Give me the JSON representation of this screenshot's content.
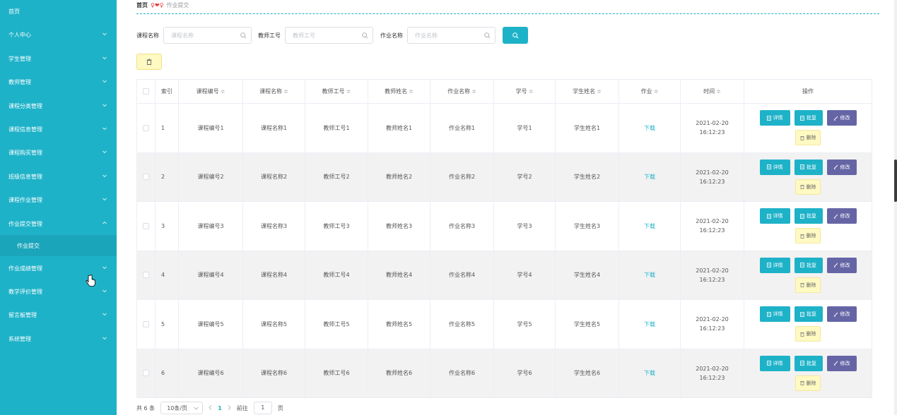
{
  "sidebar": {
    "items": [
      {
        "label": "首页",
        "chevron": false
      },
      {
        "label": "个人中心",
        "chevron": true
      },
      {
        "label": "学生管理",
        "chevron": true
      },
      {
        "label": "教师管理",
        "chevron": true
      },
      {
        "label": "课程分类管理",
        "chevron": true
      },
      {
        "label": "课程信息管理",
        "chevron": true
      },
      {
        "label": "课程购买管理",
        "chevron": true
      },
      {
        "label": "班级信息管理",
        "chevron": true
      },
      {
        "label": "课程作业管理",
        "chevron": true
      },
      {
        "label": "作业提交管理",
        "chevron": true,
        "expanded": true
      },
      {
        "label": "作业成绩管理",
        "chevron": true
      },
      {
        "label": "教学评价管理",
        "chevron": true
      },
      {
        "label": "留言板管理",
        "chevron": true
      },
      {
        "label": "系统管理",
        "chevron": true
      }
    ],
    "sub_item": "作业提交"
  },
  "breadcrumb": {
    "home": "首页",
    "separator": "♀❤♀",
    "current": "作业提交"
  },
  "filters": [
    {
      "label": "课程名称",
      "placeholder": "课程名称"
    },
    {
      "label": "教师工号",
      "placeholder": "教师工号"
    },
    {
      "label": "作业名称",
      "placeholder": "作业名称"
    }
  ],
  "table": {
    "headers": {
      "index": "索引",
      "course_no": "课程编号",
      "course_name": "课程名称",
      "teacher_no": "教师工号",
      "teacher_name": "教师姓名",
      "hw_name": "作业名称",
      "student_no": "学号",
      "student_name": "学生姓名",
      "homework": "作业",
      "time": "时间",
      "actions": "操作"
    },
    "sort_mark": "≑",
    "rows": [
      {
        "index": "1",
        "course_no": "课程编号1",
        "course_name": "课程名称1",
        "teacher_no": "教师工号1",
        "teacher_name": "教师姓名1",
        "hw_name": "作业名称1",
        "student_no": "学号1",
        "student_name": "学生姓名1",
        "homework": "下载",
        "time": "2021-02-20 16:12:23"
      },
      {
        "index": "2",
        "course_no": "课程编号2",
        "course_name": "课程名称2",
        "teacher_no": "教师工号2",
        "teacher_name": "教师姓名2",
        "hw_name": "作业名称2",
        "student_no": "学号2",
        "student_name": "学生姓名2",
        "homework": "下载",
        "time": "2021-02-20 16:12:23"
      },
      {
        "index": "3",
        "course_no": "课程编号3",
        "course_name": "课程名称3",
        "teacher_no": "教师工号3",
        "teacher_name": "教师姓名3",
        "hw_name": "作业名称3",
        "student_no": "学号3",
        "student_name": "学生姓名3",
        "homework": "下载",
        "time": "2021-02-20 16:12:23"
      },
      {
        "index": "4",
        "course_no": "课程编号4",
        "course_name": "课程名称4",
        "teacher_no": "教师工号4",
        "teacher_name": "教师姓名4",
        "hw_name": "作业名称4",
        "student_no": "学号4",
        "student_name": "学生姓名4",
        "homework": "下载",
        "time": "2021-02-20 16:12:23"
      },
      {
        "index": "5",
        "course_no": "课程编号5",
        "course_name": "课程名称5",
        "teacher_no": "教师工号5",
        "teacher_name": "教师姓名5",
        "hw_name": "作业名称5",
        "student_no": "学号5",
        "student_name": "学生姓名5",
        "homework": "下载",
        "time": "2021-02-20 16:12:23"
      },
      {
        "index": "6",
        "course_no": "课程编号6",
        "course_name": "课程名称6",
        "teacher_no": "教师工号6",
        "teacher_name": "教师姓名6",
        "hw_name": "作业名称6",
        "student_no": "学号6",
        "student_name": "学生姓名6",
        "homework": "下载",
        "time": "2021-02-20 16:12:23"
      }
    ],
    "actions": {
      "detail": "详情",
      "approve": "批复",
      "edit": "修改",
      "delete": "删除"
    }
  },
  "pagination": {
    "total": "共 6 条",
    "page_size": "10条/页",
    "current_page": "1",
    "goto_label": "前往",
    "goto_value": "1",
    "page_suffix": "页"
  },
  "colors": {
    "accent": "#1eb2c8",
    "edit": "#6565a6",
    "delete": "#fff9c2"
  }
}
